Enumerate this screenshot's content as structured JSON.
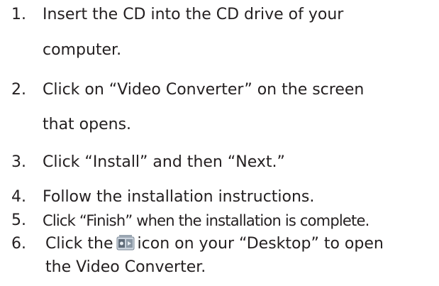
{
  "steps": [
    {
      "number": "1.",
      "lines": [
        "Insert the CD into the CD drive of your",
        "computer."
      ]
    },
    {
      "number": "2.",
      "lines": [
        "Click on “Video Converter” on the screen",
        "that opens."
      ]
    },
    {
      "number": "3.",
      "lines": [
        "Click “Install” and then “Next.”"
      ]
    },
    {
      "number": "4.",
      "lines": [
        "Follow the installation instructions."
      ]
    },
    {
      "number": "5.",
      "lines": [
        "Click “Finish” when the installation is complete."
      ]
    },
    {
      "number": "6.",
      "line1_before_icon": "Click the",
      "line1_after_icon": "icon on your “Desktop” to open",
      "line2": "the Video Converter.",
      "icon": "video-converter-app-icon"
    }
  ]
}
